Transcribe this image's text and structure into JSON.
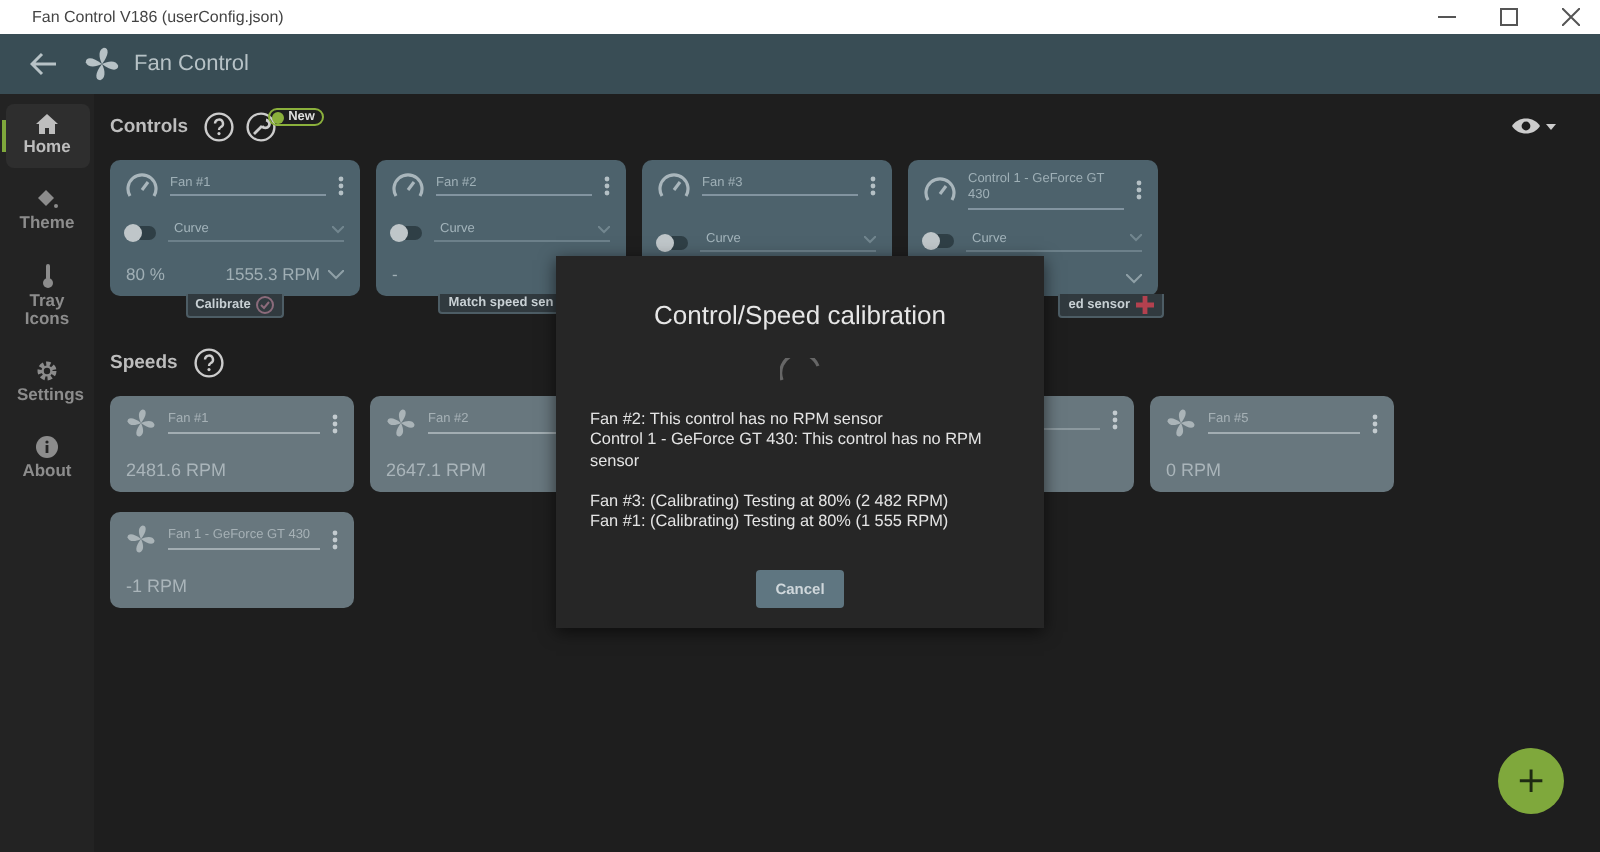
{
  "window": {
    "title": "Fan Control V186 (userConfig.json)"
  },
  "header": {
    "title": "Fan Control"
  },
  "sidebar": {
    "items": [
      {
        "label": "Home",
        "selected": true
      },
      {
        "label": "Theme",
        "selected": false
      },
      {
        "label": "Tray Icons",
        "selected": false
      },
      {
        "label": "Settings",
        "selected": false
      },
      {
        "label": "About",
        "selected": false
      }
    ]
  },
  "controls": {
    "title": "Controls",
    "badge": "New",
    "cards": [
      {
        "name": "Fan #1",
        "on": false,
        "placeholder": "Curve",
        "percent": "80 %",
        "rpm": "1555.3 RPM",
        "tag": {
          "label": "Calibrate",
          "kind": "check"
        }
      },
      {
        "name": "Fan #2",
        "on": false,
        "placeholder": "Curve",
        "percent": "-",
        "tag": {
          "label": "Match speed sen",
          "kind": "plain"
        }
      },
      {
        "name": "Fan #3",
        "on": false,
        "placeholder": "Curve"
      },
      {
        "name": "Control 1 - GeForce GT 430",
        "on": false,
        "placeholder": "Curve",
        "tag": {
          "label": "ed sensor",
          "kind": "plus"
        }
      }
    ]
  },
  "speeds": {
    "title": "Speeds",
    "rows": [
      [
        {
          "kind": "fan",
          "name": "Fan #1",
          "rpm": "2481.6 RPM"
        },
        {
          "kind": "fan",
          "name": "Fan #2",
          "rpm": "2647.1 RPM"
        },
        {
          "kind": "hidden"
        },
        {
          "kind": "covered"
        },
        {
          "kind": "fan",
          "name": "Fan #5",
          "rpm": "0 RPM"
        }
      ],
      [
        {
          "kind": "fan",
          "name": "Fan 1 - GeForce GT 430",
          "rpm": "-1 RPM"
        }
      ]
    ]
  },
  "dialog": {
    "title": "Control/Speed calibration",
    "groups": [
      [
        "Fan #2: This control has no RPM sensor",
        "Control 1 - GeForce GT 430: This control has no RPM sensor"
      ],
      [
        "Fan #3: (Calibrating) Testing at 80% (2 482 RPM)",
        "Fan #1: (Calibrating) Testing at 80% (1 555 RPM)"
      ]
    ],
    "button": "Cancel"
  },
  "fab": {
    "label": "+"
  }
}
